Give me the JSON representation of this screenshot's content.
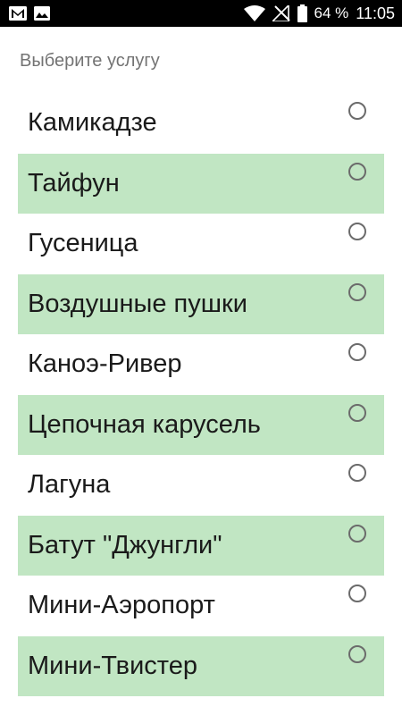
{
  "status_bar": {
    "icons": [
      "gmail-icon",
      "image-icon",
      "wifi-icon",
      "no-signal-icon",
      "battery-icon"
    ],
    "battery": "64 %",
    "time": "11:05"
  },
  "screen": {
    "title": "Выберите услугу"
  },
  "services": [
    {
      "label": "Камикадзе",
      "selected": false
    },
    {
      "label": "Тайфун",
      "selected": false
    },
    {
      "label": "Гусеница",
      "selected": false
    },
    {
      "label": "Воздушные пушки",
      "selected": false
    },
    {
      "label": "Каноэ-Ривер",
      "selected": false
    },
    {
      "label": "Цепочная карусель",
      "selected": false
    },
    {
      "label": "Лагуна",
      "selected": false
    },
    {
      "label": "Батут \"Джунгли\"",
      "selected": false
    },
    {
      "label": "Мини-Аэропорт",
      "selected": false
    },
    {
      "label": "Мини-Твистер",
      "selected": false
    }
  ],
  "colors": {
    "alt_row": "#c1e6c3",
    "status_bar": "#000000"
  }
}
